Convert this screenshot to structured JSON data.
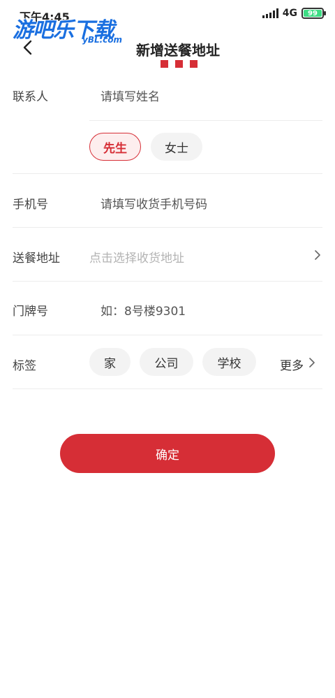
{
  "status_bar": {
    "time": "下午4:45",
    "network": "4G",
    "battery": "99",
    "battery_level": 0.99
  },
  "watermark": {
    "title": "游吧乐下载",
    "subtitle": "yBL.com"
  },
  "header": {
    "title": "新增送餐地址"
  },
  "form": {
    "contact": {
      "label": "联系人",
      "placeholder": "请填写姓名"
    },
    "gender": {
      "options": [
        "先生",
        "女士"
      ],
      "selected": "先生"
    },
    "phone": {
      "label": "手机号",
      "placeholder": "请填写收货手机号码"
    },
    "address": {
      "label": "送餐地址",
      "placeholder": "点击选择收货地址"
    },
    "door": {
      "label": "门牌号",
      "placeholder": "如：8号楼9301"
    },
    "tags": {
      "label": "标签",
      "options": [
        "家",
        "公司",
        "学校"
      ],
      "more": "更多"
    }
  },
  "actions": {
    "confirm": "确定"
  },
  "colors": {
    "accent": "#d62e36",
    "pill_bg": "#f3f3f3",
    "divider": "#ececec"
  }
}
